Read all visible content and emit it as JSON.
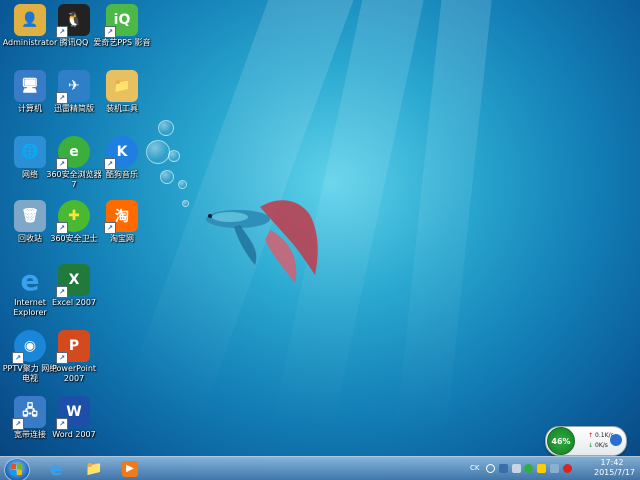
{
  "desktop": {
    "icons": [
      {
        "name": "Administrator",
        "kind": "user-folder-icon",
        "color": "#e0b040",
        "glyph": "👤",
        "shortcut": false
      },
      {
        "name": "腾讯QQ",
        "kind": "qq-penguin-icon",
        "color": "#222222",
        "glyph": "🐧",
        "shortcut": true
      },
      {
        "name": "爱奇艺PPS 影音",
        "kind": "iqiyi-icon",
        "color": "#4cb848",
        "glyph": "iQ",
        "shortcut": true
      },
      {
        "name": "计算机",
        "kind": "computer-icon",
        "color": "#3a7bc8",
        "glyph": "🖥",
        "shortcut": false
      },
      {
        "name": "迅雷精简版",
        "kind": "thunder-bird-icon",
        "color": "#2e7fc8",
        "glyph": "✈",
        "shortcut": true
      },
      {
        "name": "装机工具",
        "kind": "folder-icon",
        "color": "#e8c060",
        "glyph": "📁",
        "shortcut": false
      },
      {
        "name": "网络",
        "kind": "network-globe-icon",
        "color": "#2c8fd6",
        "glyph": "🌐",
        "shortcut": false
      },
      {
        "name": "360安全浏览器7",
        "kind": "browser-360-icon",
        "color": "#3cae3c",
        "glyph": "e",
        "shortcut": true
      },
      {
        "name": "酷狗音乐",
        "kind": "kugou-icon",
        "color": "#1f7fe0",
        "glyph": "K",
        "shortcut": true
      },
      {
        "name": "回收站",
        "kind": "recycle-bin-icon",
        "color": "#7fa8c8",
        "glyph": "🗑",
        "shortcut": false
      },
      {
        "name": "360安全卫士",
        "kind": "guard-360-icon",
        "color": "#4bb832",
        "glyph": "✚",
        "shortcut": true
      },
      {
        "name": "淘宝网",
        "kind": "taobao-icon",
        "color": "#ff6a00",
        "glyph": "淘",
        "shortcut": true
      },
      {
        "name": "Internet Explorer",
        "kind": "ie-icon",
        "color": "#2a86d8",
        "glyph": "e",
        "shortcut": false
      },
      {
        "name": "Excel 2007",
        "kind": "excel-icon",
        "color": "#1f7a3c",
        "glyph": "X",
        "shortcut": true
      },
      {
        "name": "PPTV聚力 网络电视",
        "kind": "pptv-icon",
        "color": "#1a86d8",
        "glyph": "◉",
        "shortcut": true
      },
      {
        "name": "PowerPoint 2007",
        "kind": "powerpoint-icon",
        "color": "#d24a1e",
        "glyph": "P",
        "shortcut": true
      },
      {
        "name": "宽带连接",
        "kind": "broadband-icon",
        "color": "#3a7bc8",
        "glyph": "🖧",
        "shortcut": true
      },
      {
        "name": "Word 2007",
        "kind": "word-icon",
        "color": "#1e4fa8",
        "glyph": "W",
        "shortcut": true
      }
    ]
  },
  "widget": {
    "percent": "46%",
    "upload": "0.1K/s",
    "download": "0K/s"
  },
  "taskbar": {
    "pinned": [
      {
        "kind": "ie-icon",
        "glyph": "e",
        "color": "#2a86d8"
      },
      {
        "kind": "explorer-folder-icon",
        "glyph": "📁",
        "color": "#e8c060"
      },
      {
        "kind": "media-player-icon",
        "glyph": "▶",
        "color": "#f07a1a"
      }
    ],
    "tray": {
      "language": "CK",
      "time": "17:42",
      "date": "2015/7/17"
    }
  }
}
